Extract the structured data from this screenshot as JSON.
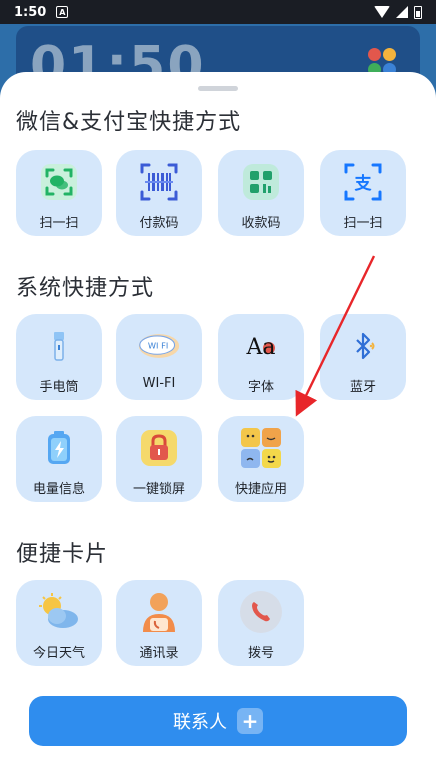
{
  "status": {
    "time": "1:50",
    "notif": "A"
  },
  "background": {
    "clock": "01:50"
  },
  "sections": {
    "wechat_alipay": {
      "title": "微信&支付宝快捷方式",
      "items": [
        {
          "label": "扫一扫",
          "icon": "wechat-scan-icon"
        },
        {
          "label": "付款码",
          "icon": "barcode-icon"
        },
        {
          "label": "收款码",
          "icon": "collect-qr-icon"
        },
        {
          "label": "扫一扫",
          "icon": "alipay-scan-icon"
        }
      ]
    },
    "system": {
      "title": "系统快捷方式",
      "items": [
        {
          "label": "手电筒",
          "icon": "flashlight-icon"
        },
        {
          "label": "WI-FI",
          "icon": "wifi-cloud-icon"
        },
        {
          "label": "字体",
          "icon": "font-icon"
        },
        {
          "label": "蓝牙",
          "icon": "bluetooth-icon"
        },
        {
          "label": "电量信息",
          "icon": "battery-info-icon"
        },
        {
          "label": "一键锁屏",
          "icon": "lock-icon"
        },
        {
          "label": "快捷应用",
          "icon": "quick-apps-icon"
        }
      ]
    },
    "cards": {
      "title": "便捷卡片",
      "items": [
        {
          "label": "今日天气",
          "icon": "weather-icon"
        },
        {
          "label": "通讯录",
          "icon": "contacts-icon"
        },
        {
          "label": "拨号",
          "icon": "phone-icon"
        }
      ]
    }
  },
  "font_icon_text": "Aa",
  "wifi_icon_text": "WI FI",
  "wechat_glyph": "支",
  "contact_button": {
    "label": "联系人",
    "plus": "+"
  },
  "colors": {
    "tile_bg": "#d5e7fb",
    "primary_button": "#2f8dee",
    "annotation_arrow": "#e8262a"
  }
}
